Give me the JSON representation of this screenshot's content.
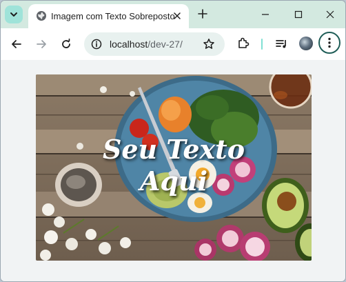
{
  "tab": {
    "title": "Imagem com Texto Sobreposto",
    "icon": "globe-icon"
  },
  "address_bar": {
    "host": "localhost",
    "path": "/dev-27/"
  },
  "page": {
    "overlay_line1": "Seu Texto",
    "overlay_line2": "Aqui",
    "image_subject": "food-bowl-photo"
  },
  "colors": {
    "tabstrip": "#d3e9e0",
    "omnibox": "#e8f1ef",
    "accent": "#1f5d57",
    "overlay_text": "#ffffff"
  }
}
